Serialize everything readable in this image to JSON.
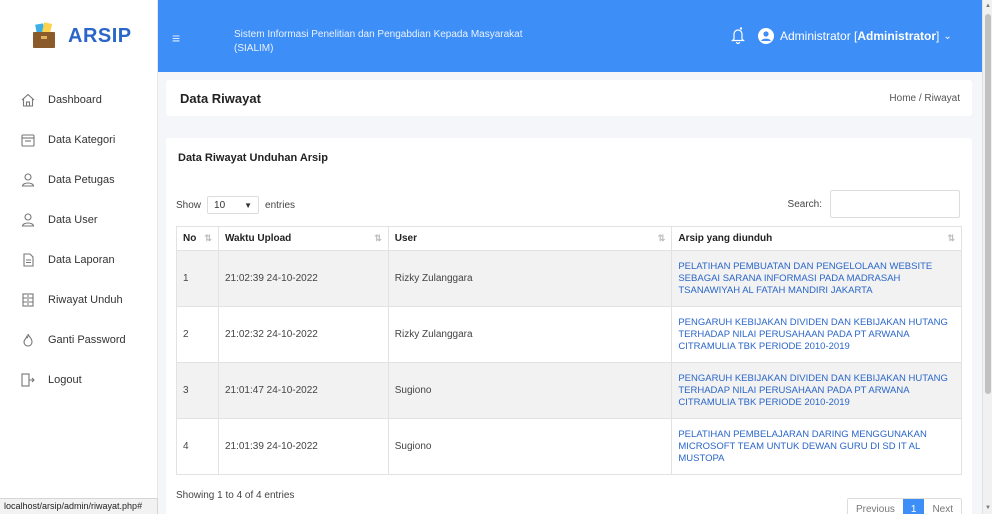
{
  "brand": {
    "name": "ARSIP"
  },
  "sidebar": {
    "items": [
      {
        "label": "Dashboard",
        "icon": "home-icon"
      },
      {
        "label": "Data Kategori",
        "icon": "folder-icon"
      },
      {
        "label": "Data Petugas",
        "icon": "user-icon"
      },
      {
        "label": "Data User",
        "icon": "user-icon"
      },
      {
        "label": "Data Laporan",
        "icon": "document-icon"
      },
      {
        "label": "Riwayat Unduh",
        "icon": "archive-icon"
      },
      {
        "label": "Ganti Password",
        "icon": "fire-icon"
      },
      {
        "label": "Logout",
        "icon": "logout-icon"
      }
    ]
  },
  "statusbar": {
    "url": "localhost/arsip/admin/riwayat.php#"
  },
  "topbar": {
    "menu_icon": "≡",
    "system_name": "Sistem Informasi Penelitian dan Pengabdian Kepada Masyarakat (SIALIM)",
    "user_label": "Administrator [ ",
    "user_role": "Administrator",
    "user_suffix": " ]"
  },
  "page": {
    "title": "Data Riwayat",
    "breadcrumb": "Home / Riwayat"
  },
  "card": {
    "title": "Data Riwayat Unduhan Arsip",
    "show_label": "Show",
    "entries_value": "10",
    "entries_label": "entries",
    "search_label": "Search:",
    "search_value": "",
    "info": "Showing 1 to 4 of 4 entries"
  },
  "table": {
    "headers": [
      "No",
      "Waktu Upload",
      "User",
      "Arsip yang diunduh"
    ],
    "rows": [
      {
        "no": "1",
        "waktu": "21:02:39 24-10-2022",
        "user": "Rizky Zulanggara",
        "arsip": "PELATIHAN PEMBUATAN DAN PENGELOLAAN WEBSITE SEBAGAI SARANA INFORMASI PADA MADRASAH TSANAWIYAH AL FATAH MANDIRI JAKARTA"
      },
      {
        "no": "2",
        "waktu": "21:02:32 24-10-2022",
        "user": "Rizky Zulanggara",
        "arsip": "PENGARUH KEBIJAKAN DIVIDEN DAN KEBIJAKAN HUTANG TERHADAP NILAI PERUSAHAAN PADA PT ARWANA CITRAMULIA TBK PERIODE 2010-2019"
      },
      {
        "no": "3",
        "waktu": "21:01:47 24-10-2022",
        "user": "Sugiono",
        "arsip": "PENGARUH KEBIJAKAN DIVIDEN DAN KEBIJAKAN HUTANG TERHADAP NILAI PERUSAHAAN PADA PT ARWANA CITRAMULIA TBK PERIODE 2010-2019"
      },
      {
        "no": "4",
        "waktu": "21:01:39 24-10-2022",
        "user": "Sugiono",
        "arsip": "PELATIHAN PEMBELAJARAN DARING MENGGUNAKAN MICROSOFT TEAM UNTUK DEWAN GURU DI SD IT AL MUSTOPA"
      }
    ]
  },
  "pagination": {
    "previous": "Previous",
    "current": "1",
    "next": "Next"
  },
  "colors": {
    "primary": "#3d8ef7",
    "link": "#2a66c9",
    "brand": "#2a66c9"
  }
}
